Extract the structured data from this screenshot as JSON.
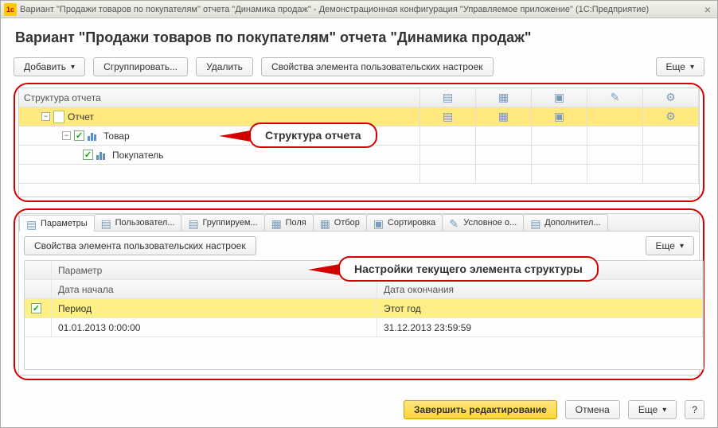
{
  "window": {
    "title": "Вариант \"Продажи товаров по покупателям\" отчета \"Динамика продаж\" - Демонстрационная конфигурация \"Управляемое приложение\"  (1С:Предприятие)"
  },
  "page_title": "Вариант \"Продажи товаров по покупателям\" отчета \"Динамика продаж\"",
  "toolbar1": {
    "add": "Добавить",
    "group": "Сгруппировать...",
    "delete": "Удалить",
    "user_props": "Свойства элемента пользовательских настроек",
    "more": "Еще"
  },
  "tree": {
    "header": "Структура отчета",
    "rows": [
      {
        "label": "Отчет",
        "level": 1,
        "selected": true,
        "expandable": true,
        "checkbox": false
      },
      {
        "label": "Товар",
        "level": 2,
        "selected": false,
        "expandable": true,
        "checkbox": true
      },
      {
        "label": "Покупатель",
        "level": 3,
        "selected": false,
        "expandable": false,
        "checkbox": true
      }
    ]
  },
  "callout1": "Структура отчета",
  "tabs": [
    {
      "label": "Параметры",
      "active": true
    },
    {
      "label": "Пользовател...",
      "active": false
    },
    {
      "label": "Группируем...",
      "active": false
    },
    {
      "label": "Поля",
      "active": false
    },
    {
      "label": "Отбор",
      "active": false
    },
    {
      "label": "Сортировка",
      "active": false
    },
    {
      "label": "Условное о...",
      "active": false
    },
    {
      "label": "Дополнител...",
      "active": false
    }
  ],
  "toolbar2": {
    "user_props": "Свойства элемента пользовательских настроек",
    "more": "Еще"
  },
  "callout2": "Настройки текущего элемента структуры",
  "params": {
    "headers": {
      "param": "Параметр",
      "start": "Дата начала",
      "end": "Дата окончания"
    },
    "rows": [
      {
        "checked": true,
        "c1": "Период",
        "c2": "Этот год"
      },
      {
        "checked": null,
        "c1": "01.01.2013 0:00:00",
        "c2": "31.12.2013 23:59:59"
      }
    ]
  },
  "footer": {
    "finish": "Завершить редактирование",
    "cancel": "Отмена",
    "more": "Еще",
    "help": "?"
  }
}
